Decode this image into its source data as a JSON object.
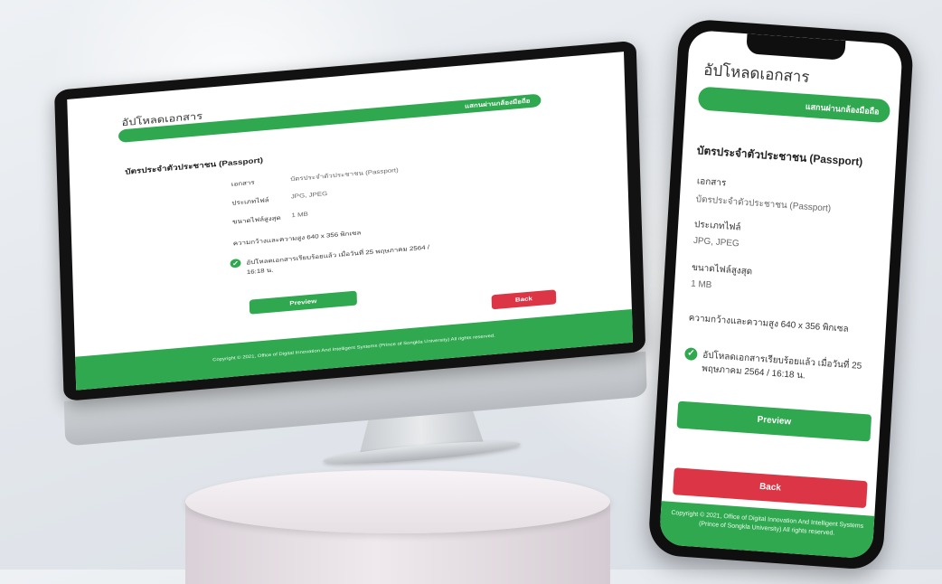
{
  "page": {
    "title": "อัปโหลดเอกสาร",
    "top_button": "แสกนผ่านกล้องมือถือ",
    "section_title": "บัตรประจำตัวประชาชน (Passport)",
    "fields": {
      "document_label": "เอกสาร",
      "document_value": "บัตรประจำตัวประชาชน (Passport)",
      "file_type_label": "ประเภทไฟล์",
      "file_type_value": "JPG, JPEG",
      "max_size_label": "ขนาดไฟล์สูงสุด",
      "max_size_value": "1 MB",
      "max_dimensions_text": "ความกว้างและความสูง 640 x 356 พิกเซล"
    },
    "uploaded_status": "อัปโหลดเอกสารเรียบร้อยแล้ว เมื่อวันที่ 25 พฤษภาคม 2564 / 16:18 น.",
    "preview_button": "Preview",
    "back_button": "Back",
    "footer_text": "Copyright © 2021, Office of Digital Innovation And Intelligent Systems (Prince of Songkla University) All rights reserved."
  },
  "colors": {
    "brand_green": "#2fa84f",
    "danger_red": "#dc3545",
    "device_black": "#121212"
  }
}
